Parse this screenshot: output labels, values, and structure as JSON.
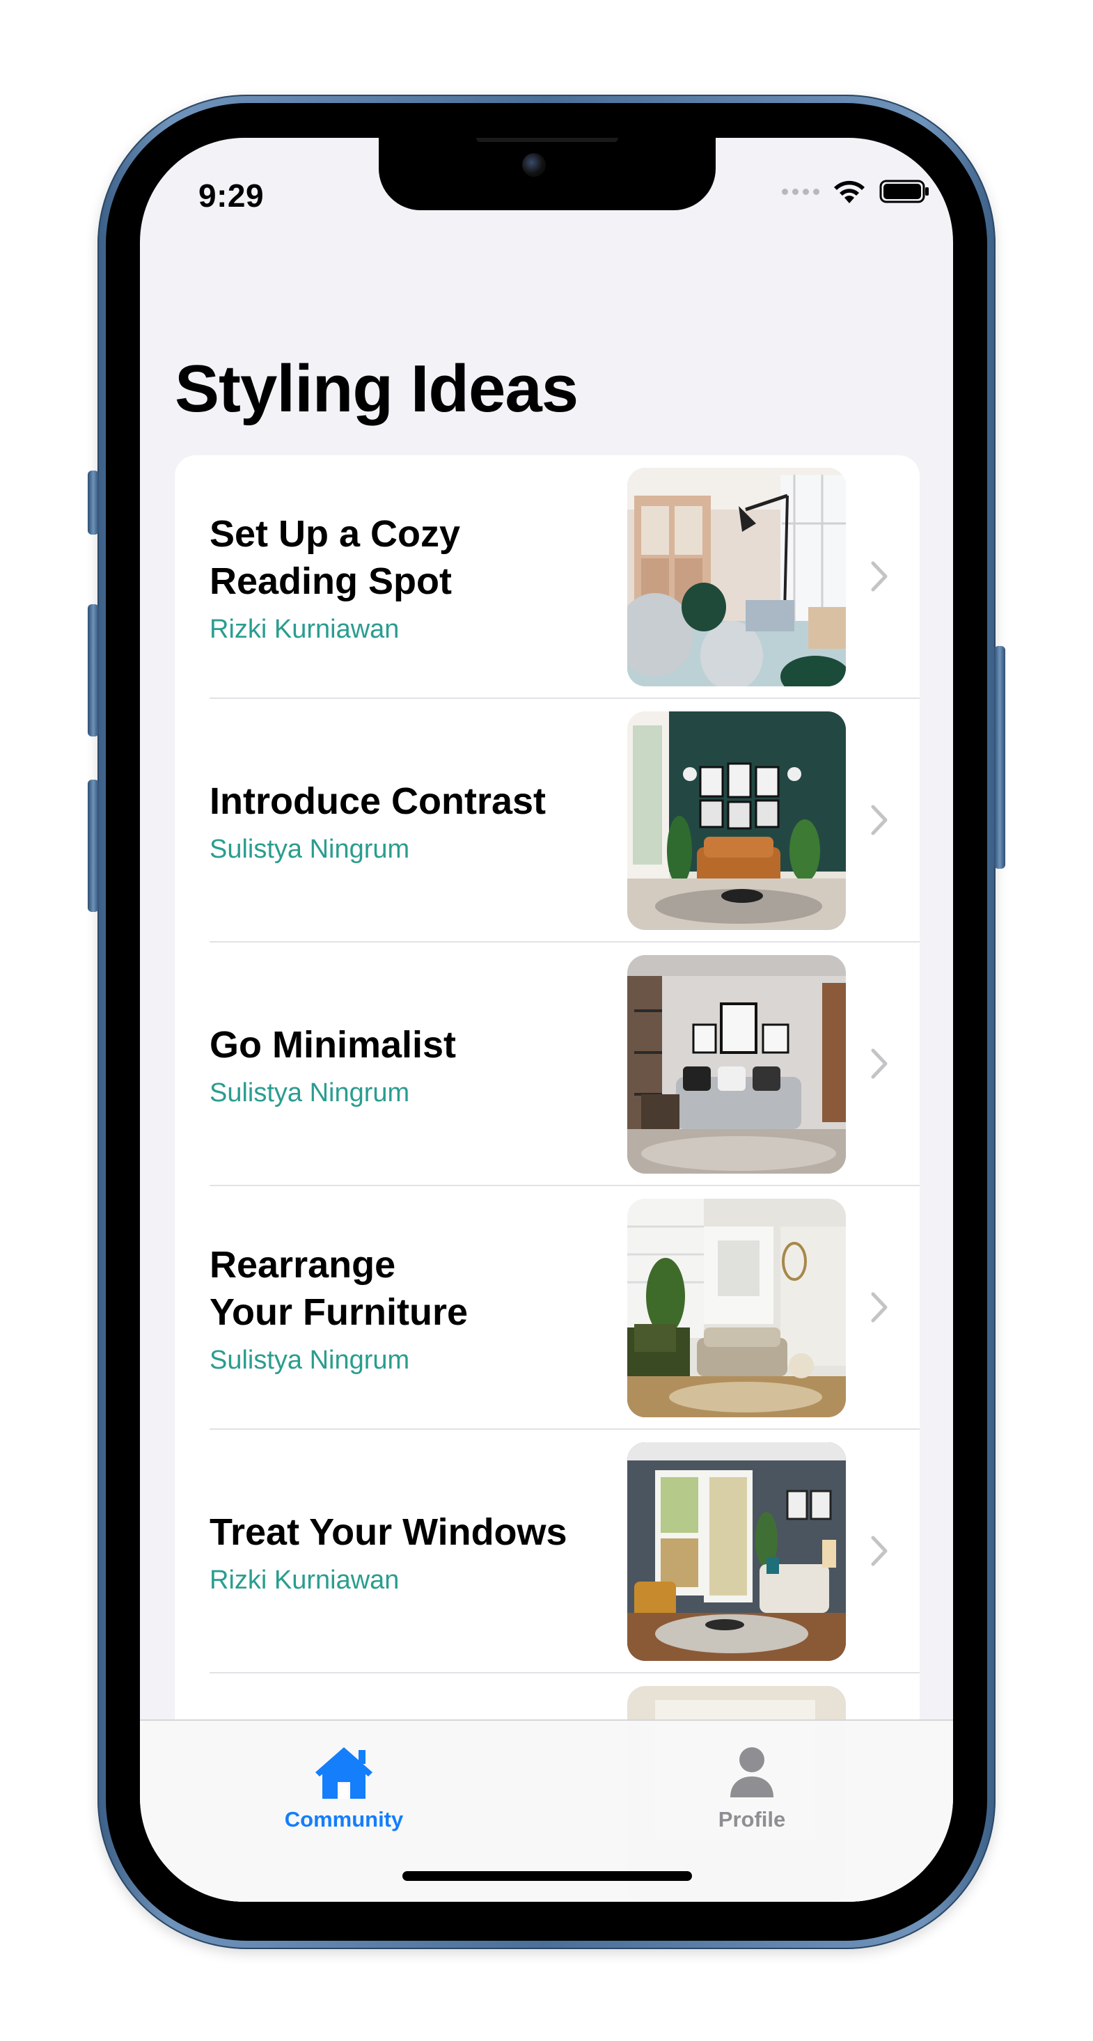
{
  "status_bar": {
    "time": "9:29"
  },
  "page": {
    "title": "Styling Ideas"
  },
  "ideas": [
    {
      "title": "Set Up a Cozy\nReading Spot",
      "author": "Rizki Kurniawan"
    },
    {
      "title": "Introduce Contrast",
      "author": "Sulistya Ningrum"
    },
    {
      "title": "Go Minimalist",
      "author": "Sulistya Ningrum"
    },
    {
      "title": "Rearrange\nYour Furniture",
      "author": "Sulistya Ningrum"
    },
    {
      "title": "Treat Your Windows",
      "author": "Rizki Kurniawan"
    }
  ],
  "tab_bar": {
    "tabs": [
      {
        "label": "Community",
        "icon": "house-fill-icon",
        "selected": true
      },
      {
        "label": "Profile",
        "icon": "person-fill-icon",
        "selected": false
      }
    ]
  },
  "colors": {
    "accent": "#147efb",
    "author_text": "#2a9d8f",
    "background": "#f2f2f7",
    "device_frame": "#4a6f98"
  }
}
